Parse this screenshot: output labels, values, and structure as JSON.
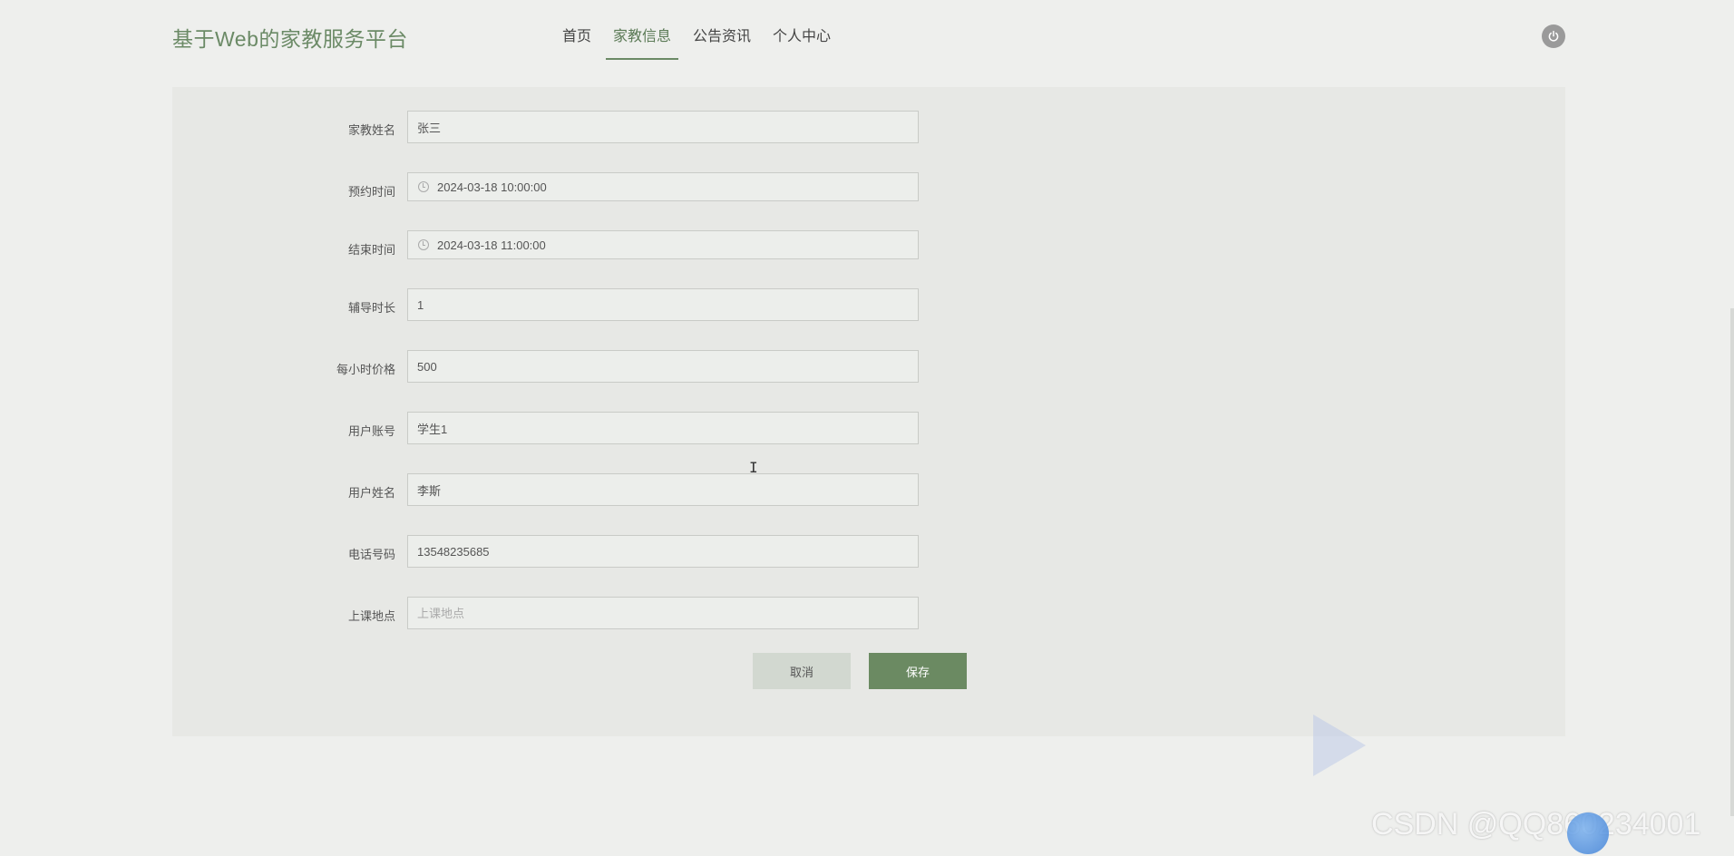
{
  "header": {
    "title": "基于Web的家教服务平台",
    "nav": [
      {
        "label": "首页",
        "active": false
      },
      {
        "label": "家教信息",
        "active": true
      },
      {
        "label": "公告资讯",
        "active": false
      },
      {
        "label": "个人中心",
        "active": false
      }
    ],
    "power_icon": "power-icon"
  },
  "form": {
    "tutor_name": {
      "label": "家教姓名",
      "value": "张三"
    },
    "appointment_time": {
      "label": "预约时间",
      "value": "2024-03-18 10:00:00"
    },
    "end_time": {
      "label": "结束时间",
      "value": "2024-03-18 11:00:00"
    },
    "duration": {
      "label": "辅导时长",
      "value": "1"
    },
    "hourly_price": {
      "label": "每小时价格",
      "value": "500"
    },
    "user_account": {
      "label": "用户账号",
      "value": "学生1"
    },
    "user_name": {
      "label": "用户姓名",
      "value": "李斯"
    },
    "phone": {
      "label": "电话号码",
      "value": "13548235685"
    },
    "location": {
      "label": "上课地点",
      "value": "",
      "placeholder": "上课地点"
    }
  },
  "buttons": {
    "cancel": "取消",
    "save": "保存"
  },
  "watermark": "CSDN @QQ860234001",
  "colors": {
    "accent": "#6b8a62",
    "title": "#6b8a66",
    "background": "#eeefed",
    "panel": "#e7e8e5"
  }
}
